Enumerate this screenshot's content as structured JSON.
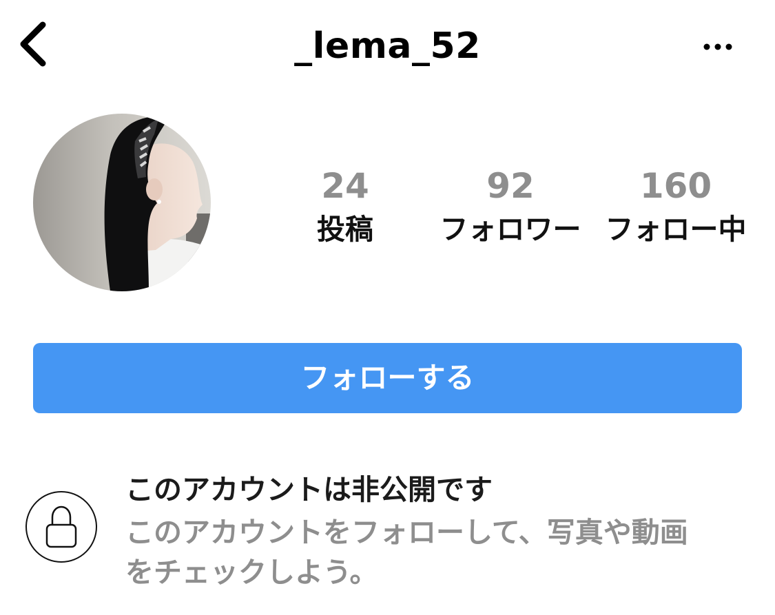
{
  "header": {
    "back_icon": "chevron-left-icon",
    "username": "_lema_52",
    "more_icon": "more-horizontal-icon"
  },
  "profile": {
    "avatar": "profile-photo",
    "stats": [
      {
        "count": "24",
        "label": "投稿"
      },
      {
        "count": "92",
        "label": "フォロワー"
      },
      {
        "count": "160",
        "label": "フォロー中"
      }
    ]
  },
  "actions": {
    "follow_label": "フォローする"
  },
  "private_notice": {
    "icon": "lock-icon",
    "title": "このアカウントは非公開です",
    "description_line1": "このアカウントをフォローして、写真や動画",
    "description_line2": "をチェックしよう。"
  },
  "colors": {
    "accent": "#4596f3",
    "muted_text": "#8e8e8e",
    "text": "#111111",
    "background": "#ffffff"
  }
}
